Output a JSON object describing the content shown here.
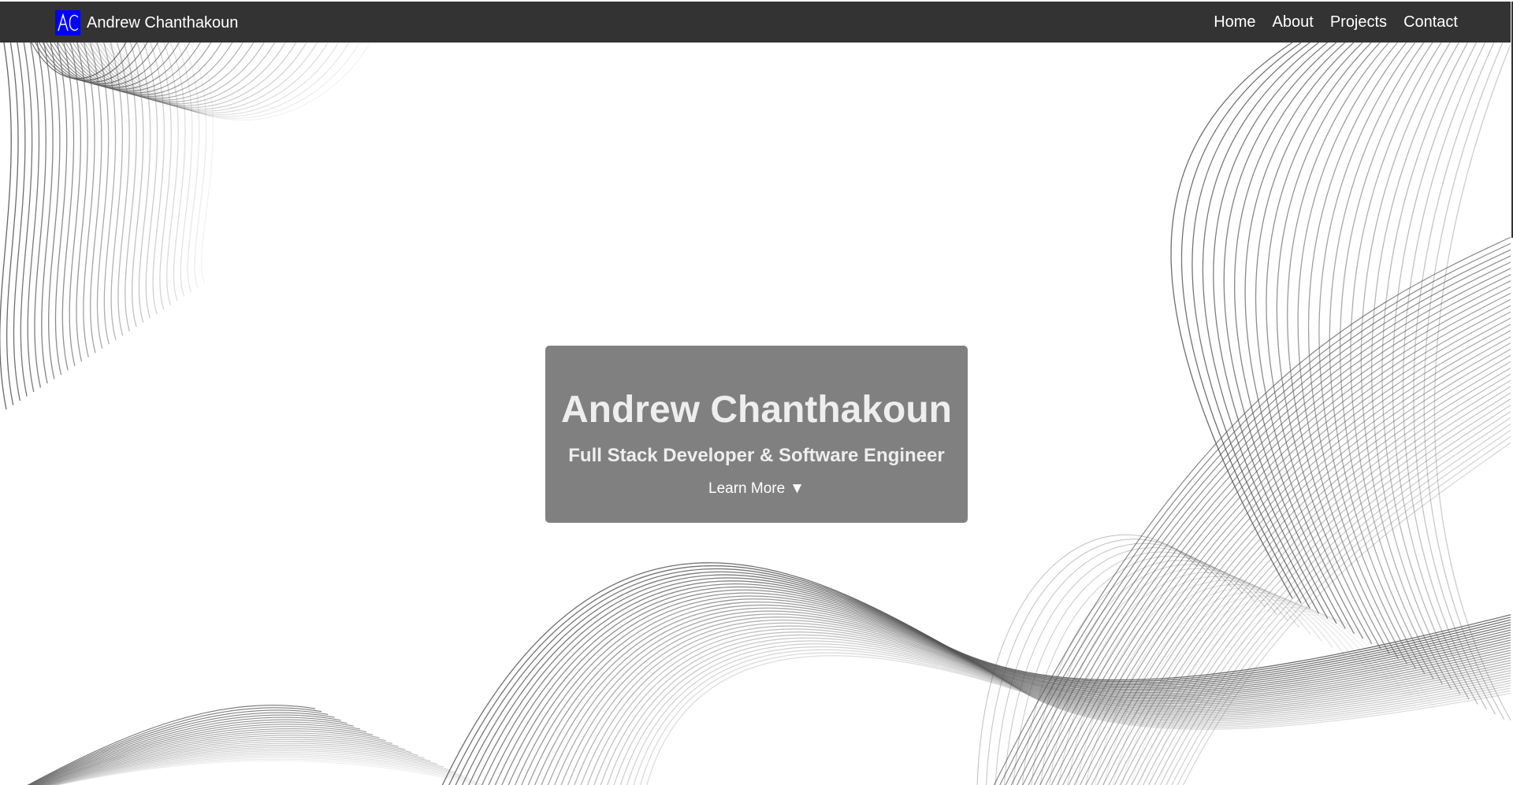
{
  "navbar": {
    "logo_text": "AC",
    "brand_name": "Andrew Chanthakoun",
    "links": [
      {
        "label": "Home"
      },
      {
        "label": "About"
      },
      {
        "label": "Projects"
      },
      {
        "label": "Contact"
      }
    ]
  },
  "hero": {
    "title": "Andrew Chanthakoun",
    "subtitle": "Full Stack Developer & Software Engineer",
    "cta_label": "Learn More",
    "cta_arrow": "▼"
  },
  "colors": {
    "navbar_bg": "#333333",
    "logo_bg": "#0000ff",
    "hero_card_bg": "#808080",
    "wave_lines": "#555555"
  }
}
